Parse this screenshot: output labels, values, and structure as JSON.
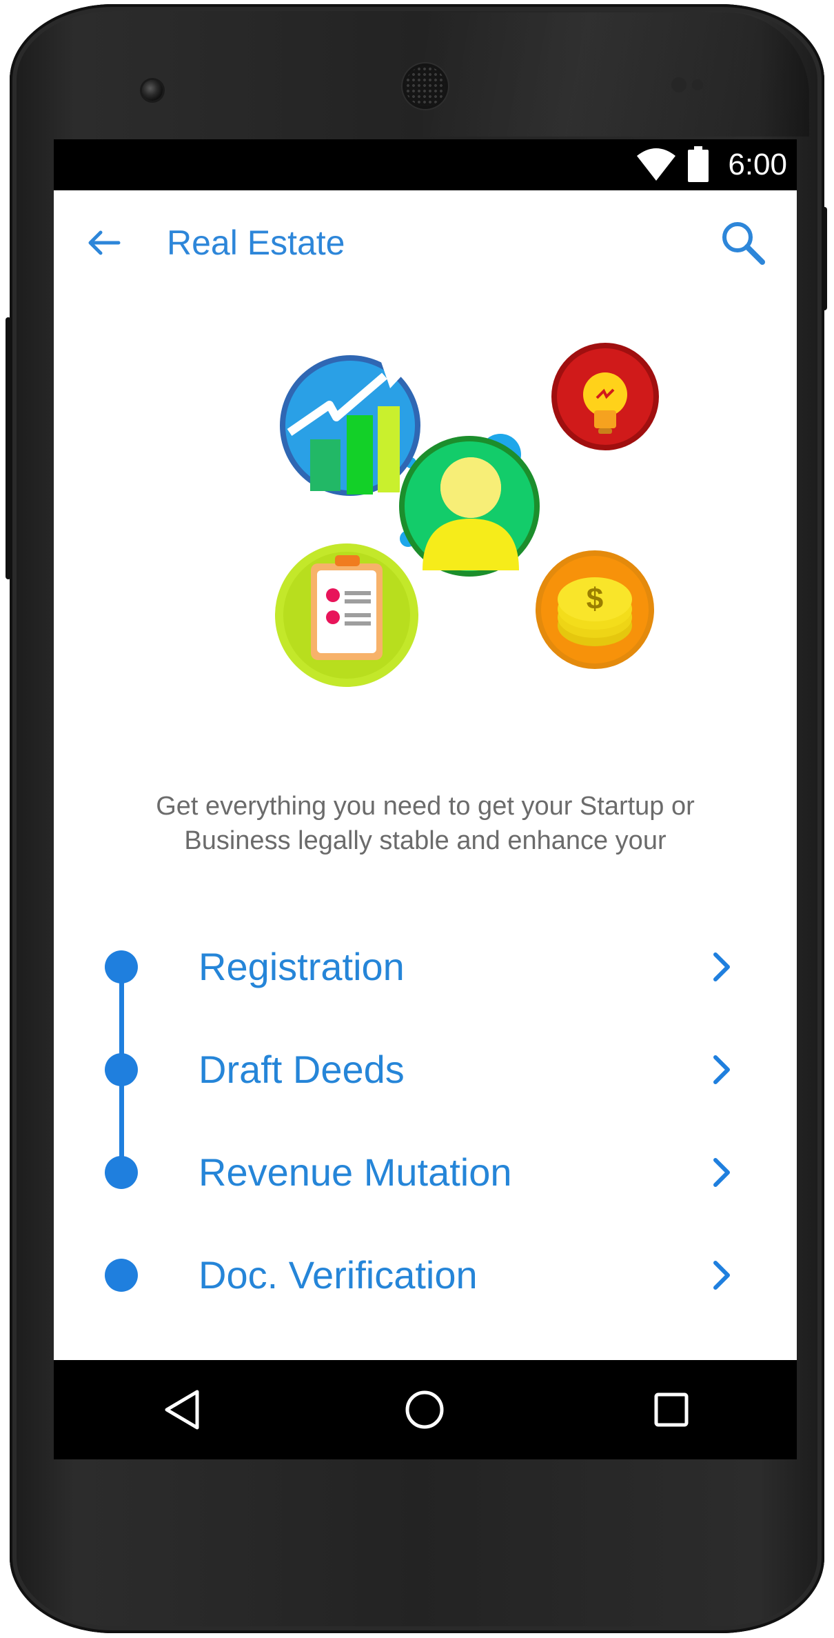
{
  "status_bar": {
    "time": "6:00",
    "icons": [
      "wifi-icon",
      "battery-icon"
    ]
  },
  "app_bar": {
    "title": "Real Estate",
    "back_icon": "arrow-left-icon",
    "search_icon": "search-icon",
    "accent_color": "#2d86d9"
  },
  "hero": {
    "illustrations": [
      "growth-chart-icon",
      "lightbulb-icon",
      "user-icon",
      "checklist-icon",
      "coins-icon"
    ]
  },
  "description": {
    "line1": "Get everything you need to get your Startup or",
    "line2": "Business legally stable and enhance your"
  },
  "menu": {
    "items": [
      {
        "label": "Registration"
      },
      {
        "label": "Draft Deeds"
      },
      {
        "label": "Revenue Mutation"
      },
      {
        "label": "Doc. Verification"
      }
    ],
    "timeline_color": "#1f7fde"
  },
  "nav_bar": {
    "buttons": [
      "nav-back-icon",
      "nav-home-icon",
      "nav-recent-icon"
    ]
  }
}
